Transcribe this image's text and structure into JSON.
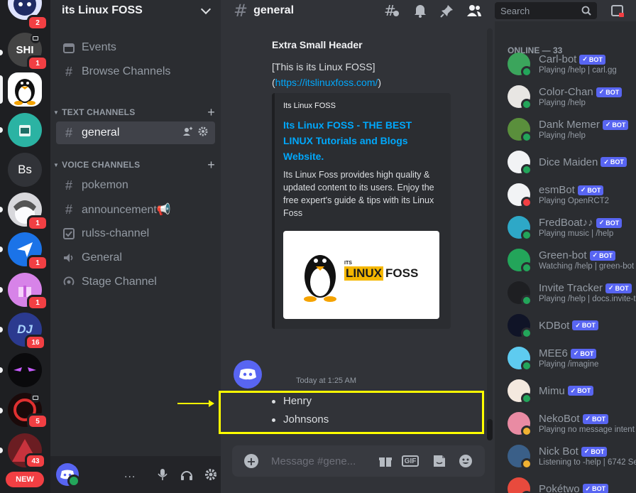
{
  "servers": {
    "badges": [
      "2",
      "1",
      "1",
      "1",
      "1",
      "16",
      "5",
      "43"
    ],
    "bs_label": "Bs",
    "new_label": "NEW"
  },
  "sidebar": {
    "guild_name": "its Linux FOSS",
    "events": "Events",
    "browse": "Browse Channels",
    "text_category": "TEXT CHANNELS",
    "voice_category": "VOICE CHANNELS",
    "channels": [
      {
        "label": "general",
        "icon": "hash-icon"
      },
      {
        "label": "pokemon",
        "icon": "hash-icon"
      },
      {
        "label": "announcement📢",
        "icon": "hash-icon"
      },
      {
        "label": "rulss-channel",
        "icon": "rules-icon"
      },
      {
        "label": "General",
        "icon": "speaker-icon"
      },
      {
        "label": "Stage Channel",
        "icon": "stage-icon"
      }
    ],
    "user_dots": "..."
  },
  "header": {
    "channel": "general",
    "search_placeholder": "Search"
  },
  "chat": {
    "small_header": "Extra Small Header",
    "line1": "[This is its Linux FOSS]",
    "line2_open": "(",
    "link": "https://itslinuxfoss.com/",
    "line2_close": ")",
    "embed": {
      "author": "Its Linux FOSS",
      "title": "Its Linux FOSS - THE BEST LINUX Tutorials and Blogs Website.",
      "description": "Its Linux Foss provides high quality & updated content to its users. Enjoy the free expert's guide & tips with its Linux Foss",
      "logo_its": "ITS",
      "logo_linux": "LINUX",
      "logo_foss": "FOSS"
    },
    "timestamp": "Today at 1:25 AM",
    "list_items": [
      "Henry",
      "Johnsons"
    ],
    "composer_placeholder": "Message #gene...",
    "gif_label": "GIF"
  },
  "members": {
    "online_header": "ONLINE — 33",
    "bot_label": "BOT",
    "items": [
      {
        "name": "Carl-bot",
        "activity": "Playing /help | carl.gg",
        "color": "#3ba55c"
      },
      {
        "name": "Color-Chan",
        "activity": "Playing /help",
        "color": "#e8e6e3"
      },
      {
        "name": "Dank Memer",
        "activity": "Playing /help",
        "color": "#5a8f3c"
      },
      {
        "name": "Dice Maiden",
        "activity": "",
        "color": "#f2f3f5"
      },
      {
        "name": "esmBot",
        "activity": "Playing OpenRCT2",
        "color": "#f2f3f5"
      },
      {
        "name": "FredBoat♪♪",
        "activity": "Playing music | /help",
        "color": "#2ea8c7"
      },
      {
        "name": "Green-bot",
        "activity": "Watching /help | green-bot",
        "color": "#23a55a"
      },
      {
        "name": "Invite Tracker",
        "activity": "Playing /help | docs.invite-t",
        "color": "#1e1f22"
      },
      {
        "name": "KDBot",
        "activity": "",
        "color": "#101427"
      },
      {
        "name": "MEE6",
        "activity": "Playing /imagine",
        "color": "#5ecbf0"
      },
      {
        "name": "Mimu",
        "activity": "",
        "color": "#f4e9df"
      },
      {
        "name": "NekoBot",
        "activity": "Playing no message intent",
        "color": "#e98ba3"
      },
      {
        "name": "Nick Bot",
        "activity": "Listening to -help | 6742 Se",
        "color": "#3a5f88"
      },
      {
        "name": "Pokétwo",
        "activity": "",
        "color": "#e84a3d"
      }
    ]
  }
}
